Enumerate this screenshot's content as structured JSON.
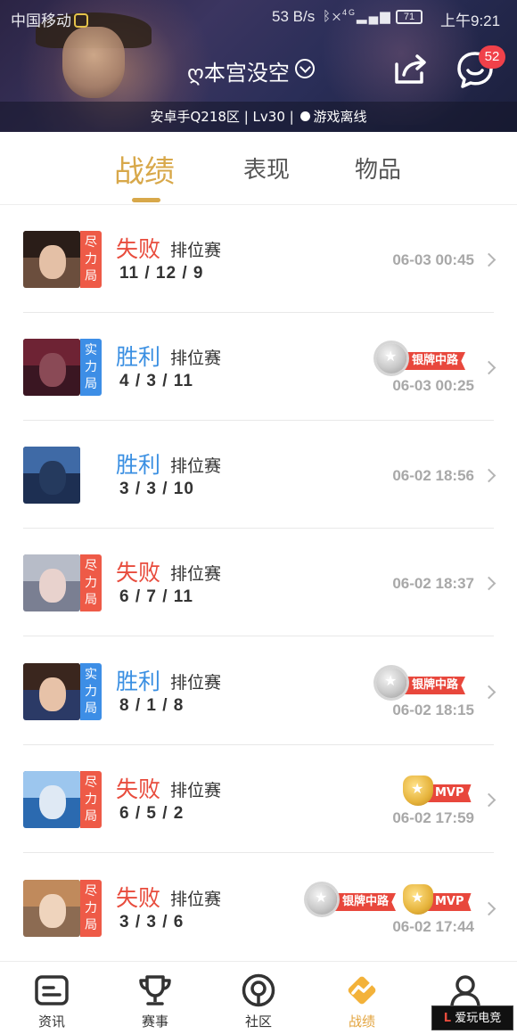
{
  "status_bar": {
    "carrier": "中国移动",
    "net_speed": "53 B/s",
    "signal_text": "4G",
    "battery": "71",
    "time": "上午9:21"
  },
  "header": {
    "account_name": "ღ本宫没空",
    "message_count": "52",
    "server": "安卓手Q218区",
    "level": "Lv30",
    "online_status": "游戏离线",
    "separator": "|"
  },
  "tabs": [
    {
      "label": "战绩",
      "active": true
    },
    {
      "label": "表现",
      "active": false
    },
    {
      "label": "物品",
      "active": false
    }
  ],
  "matches": [
    {
      "result": "失败",
      "outcome": "lose",
      "mode": "排位赛",
      "kda": "11 / 12 / 9",
      "date": "06-03 00:45",
      "tag": "尽力局",
      "badges": []
    },
    {
      "result": "胜利",
      "outcome": "win",
      "mode": "排位赛",
      "kda": "4 / 3 / 11",
      "date": "06-03 00:25",
      "tag": "实力局",
      "badges": [
        "银牌中路"
      ]
    },
    {
      "result": "胜利",
      "outcome": "win",
      "mode": "排位赛",
      "kda": "3 / 3 / 10",
      "date": "06-02 18:56",
      "tag": "",
      "badges": []
    },
    {
      "result": "失败",
      "outcome": "lose",
      "mode": "排位赛",
      "kda": "6 / 7 / 11",
      "date": "06-02 18:37",
      "tag": "尽力局",
      "badges": []
    },
    {
      "result": "胜利",
      "outcome": "win",
      "mode": "排位赛",
      "kda": "8 / 1 / 8",
      "date": "06-02 18:15",
      "tag": "实力局",
      "badges": [
        "银牌中路"
      ]
    },
    {
      "result": "失败",
      "outcome": "lose",
      "mode": "排位赛",
      "kda": "6 / 5 / 2",
      "date": "06-02 17:59",
      "tag": "尽力局",
      "badges": [
        "MVP"
      ]
    },
    {
      "result": "失败",
      "outcome": "lose",
      "mode": "排位赛",
      "kda": "3 / 3 / 6",
      "date": "06-02 17:44",
      "tag": "尽力局",
      "badges": [
        "银牌中路",
        "MVP"
      ]
    }
  ],
  "bottom_nav": [
    {
      "label": "资讯",
      "icon": "news-icon",
      "active": false
    },
    {
      "label": "赛事",
      "icon": "trophy-icon",
      "active": false
    },
    {
      "label": "社区",
      "icon": "community-icon",
      "active": false
    },
    {
      "label": "战绩",
      "icon": "record-icon",
      "active": true
    },
    {
      "label": "我",
      "icon": "profile-icon",
      "active": false
    }
  ],
  "watermark": {
    "brand": "爱玩电竞",
    "logo": "L"
  },
  "colors": {
    "accent": "#d8a84a",
    "lose": "#e84c3d",
    "win": "#3a8fe2",
    "badge_red": "#e8473c"
  }
}
